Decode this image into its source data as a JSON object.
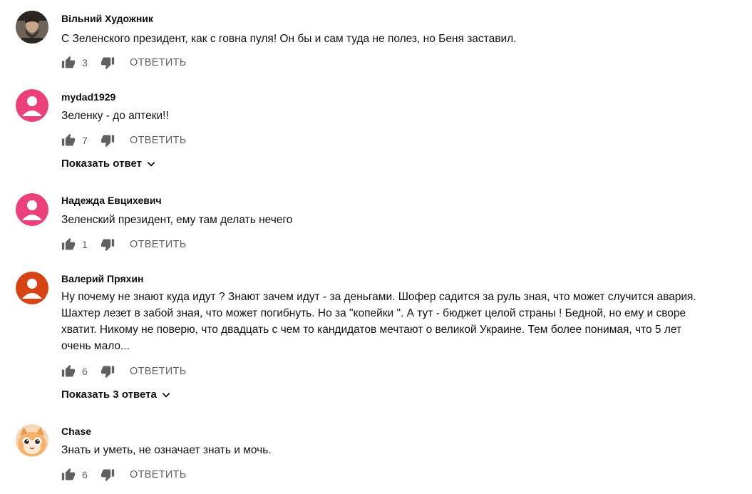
{
  "comments": [
    {
      "author": "Вільний Художник",
      "timestamp": "",
      "text": "С Зеленского президент, как с говна пуля! Он бы и сам туда не полез, но Беня заставил.",
      "likes": "3",
      "reply_label": "ОТВЕТИТЬ",
      "avatar": {
        "type": "photo",
        "color": "#3a3330",
        "letter": ""
      }
    },
    {
      "author": "mydad1929",
      "timestamp": "",
      "text": "Зеленку - до аптеки!!",
      "likes": "7",
      "reply_label": "ОТВЕТИТЬ",
      "show_replies": "Показать ответ",
      "avatar": {
        "type": "default",
        "color": "#ec407a"
      }
    },
    {
      "author": "Надежда Евцихевич",
      "timestamp": "",
      "text": "Зеленский президент, ему там делать нечего",
      "likes": "1",
      "reply_label": "ОТВЕТИТЬ",
      "avatar": {
        "type": "default",
        "color": "#ec407a"
      }
    },
    {
      "author": "Валерий Пряхин",
      "timestamp": "",
      "text_lines": [
        "Ну почему не знают куда идут ? Знают зачем идут - за деньгами. Шофер садится за руль зная, что может случится авария.",
        "Шахтер лезет в забой зная, что может погибнуть. Но за \"копейки \". А тут - бюджет целой страны ! Бедной, но ему и своре",
        "хватит. Никому не поверю, что двадцать с чем то кандидатов мечтают о великой Украине. Тем более понимая, что 5 лет",
        "очень мало..."
      ],
      "likes": "6",
      "reply_label": "ОТВЕТИТЬ",
      "show_replies": "Показать 3 ответа",
      "avatar": {
        "type": "default",
        "color": "#d84315"
      }
    },
    {
      "author": "Chase",
      "timestamp": "",
      "text": "Знать и уметь, не означает знать и мочь.",
      "likes": "6",
      "reply_label": "ОТВЕТИТЬ",
      "avatar": {
        "type": "cartoon",
        "color": "#f6b26b"
      }
    }
  ],
  "colors": {
    "text_primary": "#0f0f0f",
    "text_secondary": "#606060",
    "icon": "#606060"
  },
  "icons": {
    "like": "thumb-up-icon",
    "dislike": "thumb-down-icon",
    "expand": "chevron-down-icon"
  }
}
